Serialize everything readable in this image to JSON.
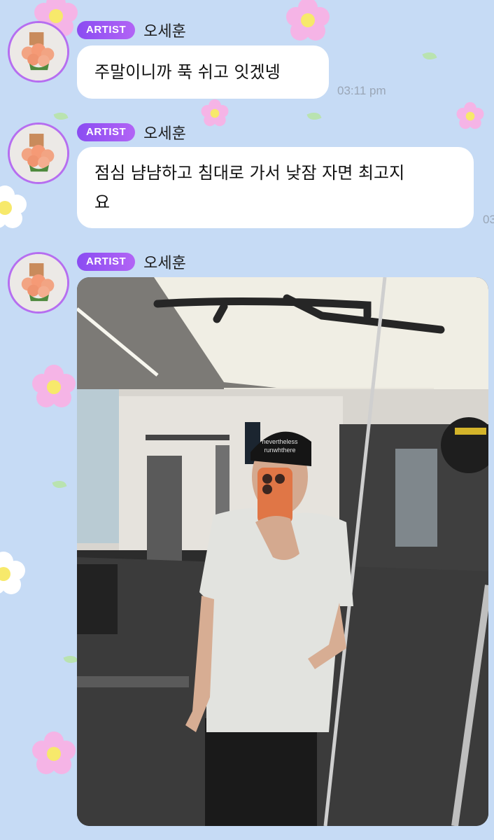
{
  "messages": [
    {
      "badge": "ARTIST",
      "sender": "오세훈",
      "text": "주말이니까 푹 쉬고 잇겠넹",
      "time": "03:11 pm"
    },
    {
      "badge": "ARTIST",
      "sender": "오세훈",
      "text_line1": "점심 냠냠하고 침대로 가서 낮잠 자면 최고지",
      "text_line2": "요",
      "time_partial": "03"
    },
    {
      "badge": "ARTIST",
      "sender": "오세훈",
      "photo_desc": "gym-mirror-selfie"
    }
  ],
  "photo_text": {
    "cap_line1": "nevertheless",
    "cap_line2": "runwhthere"
  },
  "colors": {
    "background": "#c6dbf5",
    "badge_start": "#8a4cf2",
    "badge_end": "#b264f5",
    "avatar_ring": "#b66ef0",
    "bubble": "#ffffff",
    "time": "#9aa6b6"
  }
}
